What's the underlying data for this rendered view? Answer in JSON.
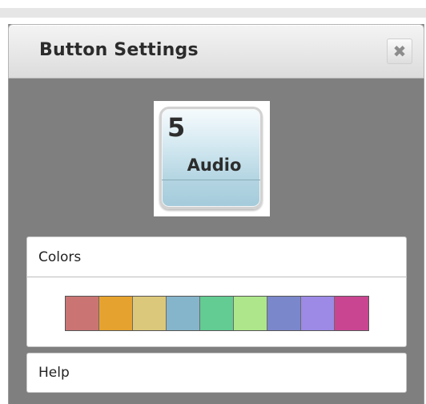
{
  "panel": {
    "title": "Button Settings",
    "close_glyph": "✖",
    "close_icon": "close-icon"
  },
  "preview": {
    "number": "5",
    "label": "Audio"
  },
  "colors": {
    "heading": "Colors",
    "swatches": [
      "#cb7474",
      "#e6a22e",
      "#dcc87a",
      "#85b5cb",
      "#62cc92",
      "#ade68b",
      "#7b87cb",
      "#9c8ae6",
      "#ca4591"
    ]
  },
  "help": {
    "heading": "Help"
  }
}
